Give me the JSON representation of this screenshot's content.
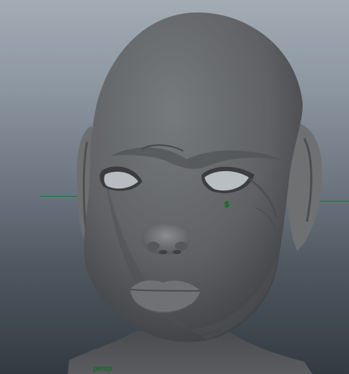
{
  "viewport": {
    "camera_name": "persp",
    "pivot_symbol": "$",
    "label_color": "#0b6e1e",
    "background_top": "#a3acb5",
    "background_bottom": "#333a42",
    "model_color": "#6a6c6e"
  }
}
